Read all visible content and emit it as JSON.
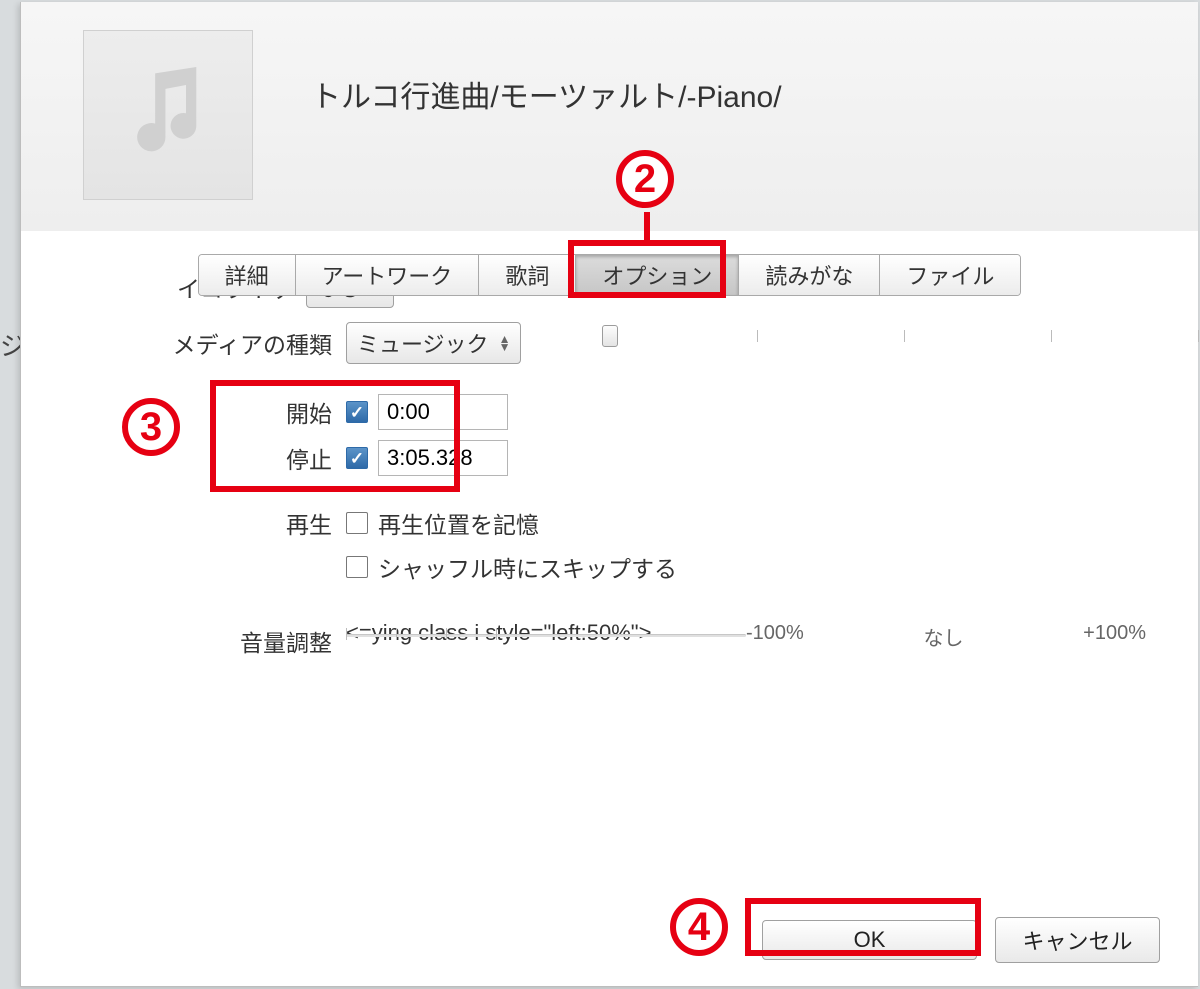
{
  "title": "トルコ行進曲/モーツァルト/-Piano/",
  "bg_char": "ジ",
  "tabs": {
    "details": "詳細",
    "artwork": "アートワーク",
    "lyrics": "歌詞",
    "options": "オプション",
    "sort": "読みがな",
    "file": "ファイル"
  },
  "media": {
    "label": "メディアの種類",
    "value": "ミュージック"
  },
  "start": {
    "label": "開始",
    "value": "0:00",
    "checked": true
  },
  "stop": {
    "label": "停止",
    "value": "3:05.328",
    "checked": true
  },
  "playback": {
    "label": "再生",
    "remember": {
      "label": "再生位置を記憶",
      "checked": false
    },
    "skip": {
      "label": "シャッフル時にスキップする",
      "checked": false
    }
  },
  "volume": {
    "label": "音量調整",
    "min": "-100%",
    "mid": "なし",
    "max": "+100%"
  },
  "eq": {
    "label": "イコライザ",
    "value": "なし"
  },
  "buttons": {
    "ok": "OK",
    "cancel": "キャンセル"
  },
  "annot": {
    "n2": "2",
    "n3": "3",
    "n4": "4"
  }
}
